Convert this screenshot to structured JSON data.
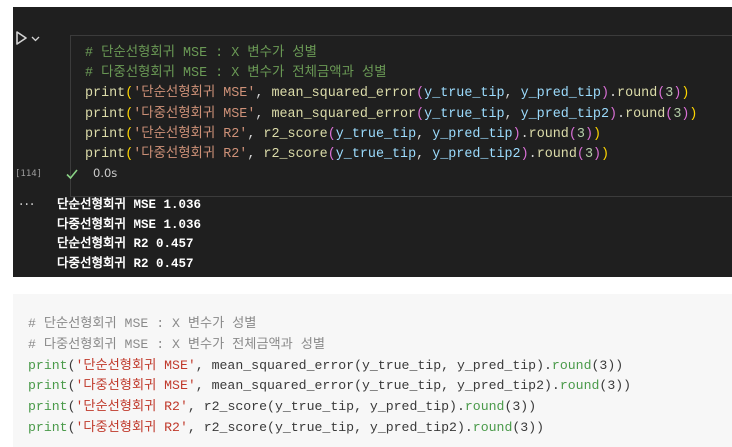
{
  "cell": {
    "execution_count": "[114]",
    "exec_time": "0.0s",
    "code_lines": [
      {
        "comment": "# 단순선형회귀 MSE : X 변수가 성별"
      },
      {
        "comment": "# 다중선형회귀 MSE : X 변수가 전체금액과 성별"
      },
      {
        "fn": "print",
        "label": "'단순선형회귀 MSE'",
        "metric": "mean_squared_error",
        "arg1": "y_true_tip",
        "arg2": "y_pred_tip",
        "round": "round",
        "digits": "3"
      },
      {
        "fn": "print",
        "label": "'다중선형회귀 MSE'",
        "metric": "mean_squared_error",
        "arg1": "y_true_tip",
        "arg2": "y_pred_tip2",
        "round": "round",
        "digits": "3"
      },
      {
        "fn": "print",
        "label": "'단순선형회귀 R2'",
        "metric": "r2_score",
        "arg1": "y_true_tip",
        "arg2": "y_pred_tip",
        "round": "round",
        "digits": "3"
      },
      {
        "fn": "print",
        "label": "'다중선형회귀 R2'",
        "metric": "r2_score",
        "arg1": "y_true_tip",
        "arg2": "y_pred_tip2",
        "round": "round",
        "digits": "3"
      }
    ],
    "output_ellipsis": "...",
    "output_lines": [
      "단순선형회귀 MSE 1.036",
      "다중선형회귀 MSE 1.036",
      "단순선형회귀 R2 0.457",
      "다중선형회귀 R2 0.457"
    ]
  },
  "snippet": {
    "code_lines": [
      {
        "comment": "# 단순선형회귀 MSE : X 변수가 성별"
      },
      {
        "comment": "# 다중선형회귀 MSE : X 변수가 전체금액과 성별"
      },
      {
        "fn": "print",
        "label": "'단순선형회귀 MSE'",
        "metric": "mean_squared_error",
        "arg1": "y_true_tip",
        "arg2": "y_pred_tip",
        "round": "round",
        "digits": "3"
      },
      {
        "fn": "print",
        "label": "'다중선형회귀 MSE'",
        "metric": "mean_squared_error",
        "arg1": "y_true_tip",
        "arg2": "y_pred_tip2",
        "round": "round",
        "digits": "3"
      },
      {
        "fn": "print",
        "label": "'단순선형회귀 R2'",
        "metric": "r2_score",
        "arg1": "y_true_tip",
        "arg2": "y_pred_tip",
        "round": "round",
        "digits": "3"
      },
      {
        "fn": "print",
        "label": "'다중선형회귀 R2'",
        "metric": "r2_score",
        "arg1": "y_true_tip",
        "arg2": "y_pred_tip2",
        "round": "round",
        "digits": "3"
      }
    ]
  },
  "colors": {
    "cell_background": "#1f1f1f",
    "snippet_background": "#f7f7f7",
    "check_icon": "#89d185"
  }
}
